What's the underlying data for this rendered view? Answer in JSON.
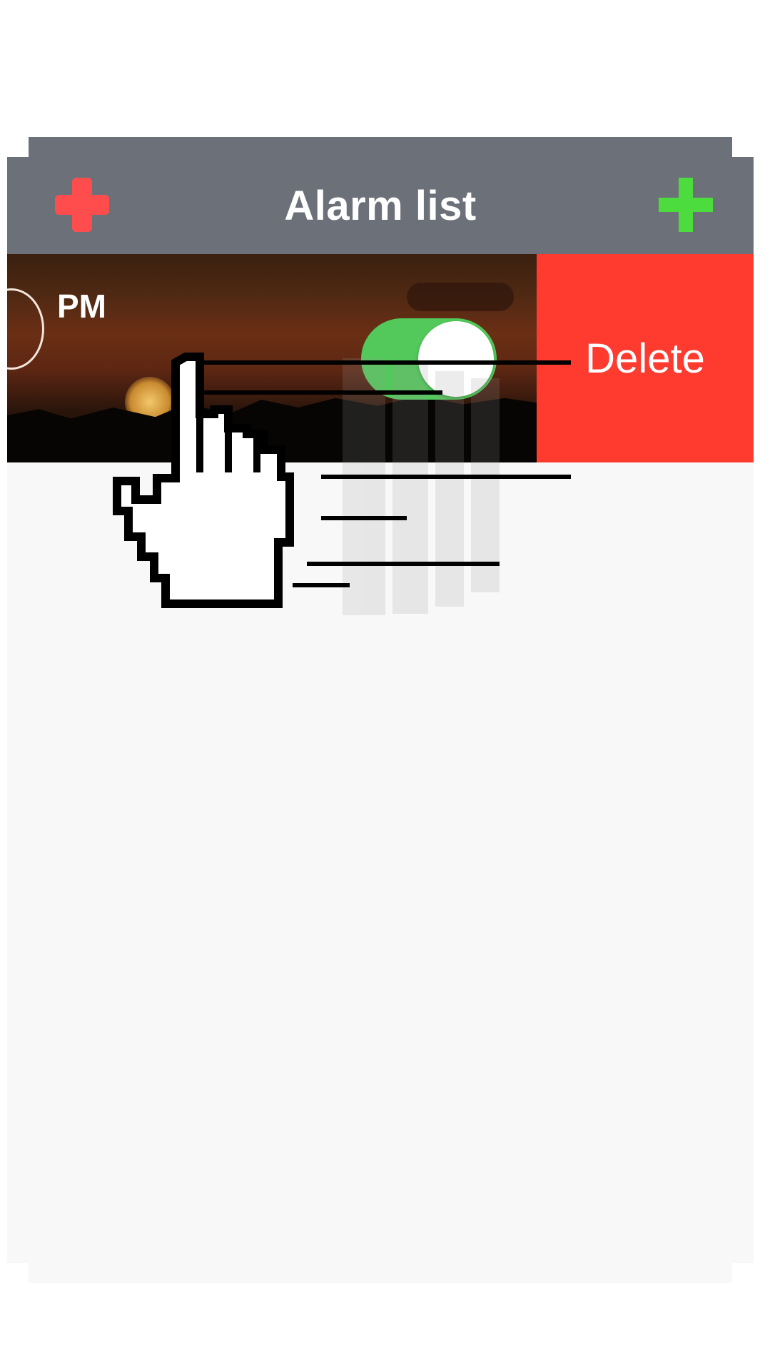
{
  "nav": {
    "title": "Alarm list",
    "left_icon": "plus-icon",
    "left_icon_color": "#ff4d4d",
    "right_icon": "plus-icon",
    "right_icon_color": "#4ddc3e",
    "background": "#6c7179"
  },
  "alarm": {
    "period": "PM",
    "enabled": true,
    "toggle_color": "#52c95a",
    "delete_label": "Delete",
    "delete_color": "#ff3b30"
  },
  "gesture": {
    "icon": "hand-cursor-icon",
    "direction": "swipe-left"
  }
}
